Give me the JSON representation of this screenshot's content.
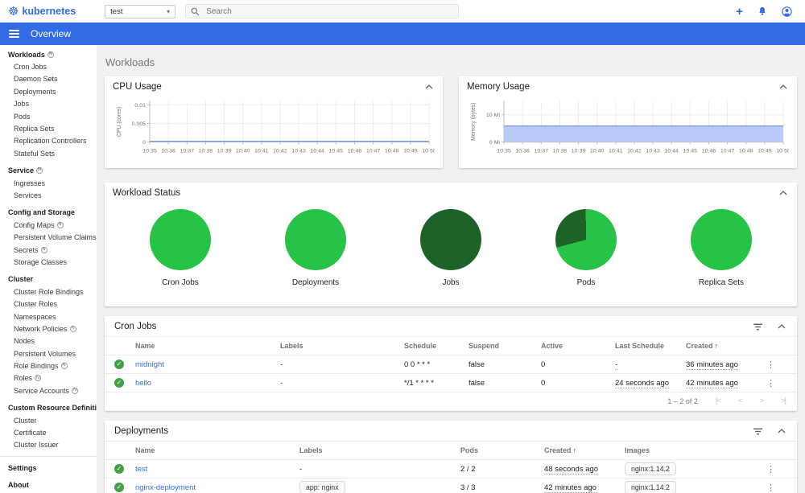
{
  "header": {
    "brand": "kubernetes",
    "namespace": {
      "value": "test"
    },
    "search": {
      "placeholder": "Search"
    }
  },
  "appbar": {
    "title": "Overview"
  },
  "page": {
    "title": "Workloads"
  },
  "icons": {
    "badge_letter": "N",
    "check": "✓",
    "kebab": "⋮",
    "sort_asc": "↑",
    "caret_down": "▾",
    "plus": "+",
    "first_page": "|<",
    "prev_page": "<",
    "next_page": ">",
    "last_page": ">|"
  },
  "colors": {
    "accent": "#326ce5",
    "success": "#43a047",
    "pie_green": "#27c346",
    "pie_dark_green": "#1d6327",
    "chart_line": "#7b96f5",
    "chart_fill": "#b3c4f7"
  },
  "sidebar": {
    "entries": [
      {
        "label": "Workloads",
        "kind": "group",
        "badge": true
      },
      {
        "label": "Cron Jobs",
        "kind": "item"
      },
      {
        "label": "Daemon Sets",
        "kind": "item"
      },
      {
        "label": "Deployments",
        "kind": "item"
      },
      {
        "label": "Jobs",
        "kind": "item"
      },
      {
        "label": "Pods",
        "kind": "item"
      },
      {
        "label": "Replica Sets",
        "kind": "item"
      },
      {
        "label": "Replication Controllers",
        "kind": "item"
      },
      {
        "label": "Stateful Sets",
        "kind": "item"
      },
      {
        "label": "Service",
        "kind": "group",
        "badge": true
      },
      {
        "label": "Ingresses",
        "kind": "item"
      },
      {
        "label": "Services",
        "kind": "item"
      },
      {
        "label": "Config and Storage",
        "kind": "group"
      },
      {
        "label": "Config Maps",
        "kind": "item",
        "badge": true
      },
      {
        "label": "Persistent Volume Claims",
        "kind": "item",
        "badge": true
      },
      {
        "label": "Secrets",
        "kind": "item",
        "badge": true
      },
      {
        "label": "Storage Classes",
        "kind": "item"
      },
      {
        "label": "Cluster",
        "kind": "group"
      },
      {
        "label": "Cluster Role Bindings",
        "kind": "item"
      },
      {
        "label": "Cluster Roles",
        "kind": "item"
      },
      {
        "label": "Namespaces",
        "kind": "item"
      },
      {
        "label": "Network Policies",
        "kind": "item",
        "badge": true
      },
      {
        "label": "Nodes",
        "kind": "item"
      },
      {
        "label": "Persistent Volumes",
        "kind": "item"
      },
      {
        "label": "Role Bindings",
        "kind": "item",
        "badge": true
      },
      {
        "label": "Roles",
        "kind": "item",
        "badge": true
      },
      {
        "label": "Service Accounts",
        "kind": "item",
        "badge": true
      },
      {
        "label": "Custom Resource Definitions",
        "kind": "group"
      },
      {
        "label": "Cluster",
        "kind": "item"
      },
      {
        "label": "Certificate",
        "kind": "item"
      },
      {
        "label": "Cluster Issuer",
        "kind": "item"
      },
      {
        "kind": "divider"
      },
      {
        "label": "Settings",
        "kind": "group"
      },
      {
        "label": "About",
        "kind": "group"
      }
    ]
  },
  "chart_data": [
    {
      "type": "area",
      "title": "CPU Usage",
      "ylabel": "CPU (cores)",
      "x": [
        "10:35",
        "10:36",
        "10:37",
        "10:38",
        "10:39",
        "10:40",
        "10:41",
        "10:42",
        "10:43",
        "10:44",
        "10:45",
        "10:46",
        "10:47",
        "10:48",
        "10:49",
        "10:50"
      ],
      "values": [
        0.0002,
        0.0002,
        0.0002,
        0.0002,
        0.0002,
        0.0002,
        0.0002,
        0.0002,
        0.0002,
        0.0002,
        0.0002,
        0.0002,
        0.0002,
        0.0002,
        0.0002,
        0.0002
      ],
      "yticks": [
        {
          "v": 0,
          "label": "0"
        },
        {
          "v": 0.005,
          "label": "0.005"
        },
        {
          "v": 0.01,
          "label": "0.01"
        }
      ],
      "ylim": [
        0,
        0.011
      ],
      "line_color": "#7b96f5",
      "fill_color": "#b3c4f7"
    },
    {
      "type": "area",
      "title": "Memory Usage",
      "ylabel": "Memory (bytes)",
      "x": [
        "10:35",
        "10:36",
        "10:37",
        "10:38",
        "10:39",
        "10:40",
        "10:41",
        "10:42",
        "10:43",
        "10:44",
        "10:45",
        "10:46",
        "10:47",
        "10:48",
        "10:49",
        "10:50"
      ],
      "values": [
        5.9,
        5.9,
        5.9,
        5.9,
        5.9,
        5.9,
        5.9,
        5.9,
        5.9,
        5.9,
        5.9,
        5.9,
        5.9,
        5.9,
        5.9,
        5.9
      ],
      "yticks": [
        {
          "v": 0,
          "label": "0 Mi"
        },
        {
          "v": 10,
          "label": "10 Mi"
        }
      ],
      "ylim": [
        0,
        15
      ],
      "line_color": "#7b96f5",
      "fill_color": "#b3c4f7"
    },
    {
      "type": "pie",
      "title": "Workload Status",
      "pies": [
        {
          "label": "Cron Jobs",
          "segments": [
            {
              "name": "running",
              "color": "#27c346",
              "pct": 100
            }
          ]
        },
        {
          "label": "Deployments",
          "segments": [
            {
              "name": "running",
              "color": "#27c346",
              "pct": 100
            }
          ]
        },
        {
          "label": "Jobs",
          "segments": [
            {
              "name": "succeeded",
              "color": "#1d6327",
              "pct": 100
            }
          ]
        },
        {
          "label": "Pods",
          "from_deg": -105,
          "segments": [
            {
              "name": "succeeded",
              "color": "#1d6327",
              "pct": 29
            },
            {
              "name": "running",
              "color": "#27c346",
              "pct": 71
            }
          ]
        },
        {
          "label": "Replica Sets",
          "segments": [
            {
              "name": "running",
              "color": "#27c346",
              "pct": 100
            }
          ]
        }
      ]
    }
  ],
  "tables": {
    "cron_jobs": {
      "title": "Cron Jobs",
      "columns": [
        "",
        "Name",
        "Labels",
        "Schedule",
        "Suspend",
        "Active",
        "Last Schedule",
        "Created",
        ""
      ],
      "sort_column": "Created",
      "rows": [
        {
          "status": "success",
          "name": "midnight",
          "labels": "-",
          "schedule": "0 0 * * *",
          "suspend": "false",
          "active": "0",
          "last_schedule": "-",
          "created": "36 minutes ago"
        },
        {
          "status": "success",
          "name": "hello",
          "labels": "-",
          "schedule": "*/1 * * * *",
          "suspend": "false",
          "active": "0",
          "last_schedule": "24 seconds ago",
          "created": "42 minutes ago"
        }
      ],
      "pagination": {
        "label": "1 – 2 of 2"
      }
    },
    "deployments": {
      "title": "Deployments",
      "columns": [
        "",
        "Name",
        "Labels",
        "Pods",
        "Created",
        "Images",
        ""
      ],
      "sort_column": "Created",
      "rows": [
        {
          "status": "success",
          "name": "test",
          "labels": "-",
          "pods": "2 / 2",
          "created": "48 seconds ago",
          "images": [
            "nginx:1.14.2"
          ]
        },
        {
          "status": "success",
          "name": "nginx-deployment",
          "labels_chip": "app: nginx",
          "pods": "3 / 3",
          "created": "42 minutes ago",
          "images": [
            "nginx:1.14.2"
          ]
        }
      ]
    }
  }
}
